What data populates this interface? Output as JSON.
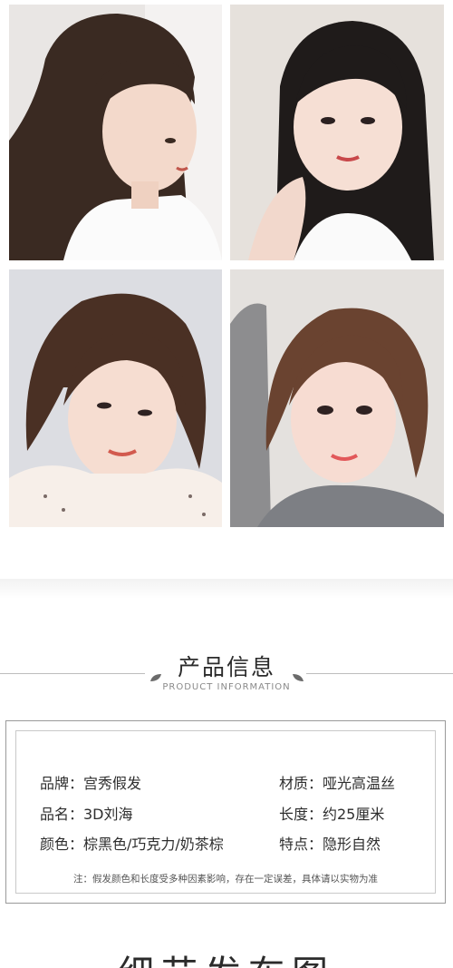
{
  "photos": [
    {
      "alt": "model-side-profile"
    },
    {
      "alt": "model-straight-hair"
    },
    {
      "alt": "model-short-bangs"
    },
    {
      "alt": "model-brown-bangs"
    }
  ],
  "section": {
    "title": "产品信息",
    "subtitle": "PRODUCT INFORMATION"
  },
  "info": {
    "rows": [
      {
        "left": "品牌：宫秀假发",
        "right": "材质：哑光高温丝"
      },
      {
        "left": "品名：3D刘海",
        "right": "长度：约25厘米"
      },
      {
        "left": "颜色：棕黑色/巧克力/奶茶棕",
        "right": "特点：隐形自然"
      }
    ],
    "note": "注：假发颜色和长度受多种因素影响，存在一定误差，具体请以实物为准"
  },
  "next_section": {
    "title": "细节发布图"
  },
  "colors": {
    "line": "#bdbdbd",
    "box_border": "#9a9a9a",
    "text": "#2e2e2e"
  }
}
